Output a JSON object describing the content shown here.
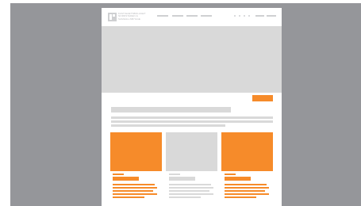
{
  "header": {
    "logo_lines": [
      "FASTIGHETSBOLAGET",
      "NORDSTADEN &",
      "SAMHÄLLSBYGGE"
    ]
  },
  "colors": {
    "accent": "#f68b2a",
    "placeholder": "#d9d9d9",
    "backdrop": "#95969a",
    "page": "#ffffff"
  }
}
